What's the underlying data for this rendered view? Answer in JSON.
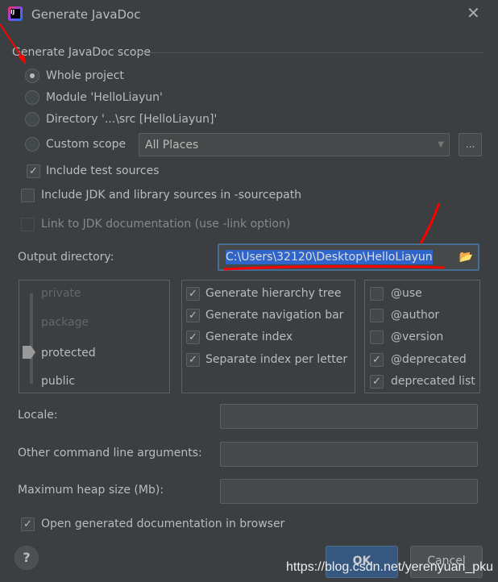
{
  "window": {
    "title": "Generate JavaDoc",
    "icon": "intellij-idea-icon"
  },
  "scope": {
    "title": "Generate JavaDoc scope",
    "options": [
      {
        "label": "Whole project",
        "selected": true
      },
      {
        "label": "Module 'HelloLiayun'",
        "selected": false
      },
      {
        "label": "Directory '...\\src [HelloLiayun]'",
        "selected": false
      },
      {
        "label": "Custom scope",
        "selected": false
      }
    ],
    "custom_scope_value": "All Places",
    "browse_label": "...",
    "include_test": {
      "label": "Include test sources",
      "checked": true
    }
  },
  "include_jdk": {
    "label": "Include JDK and library sources in -sourcepath",
    "checked": false
  },
  "link_jdk": {
    "label": "Link to JDK documentation (use -link option)",
    "checked": false,
    "enabled": false
  },
  "output": {
    "label": "Output directory:",
    "value": "C:\\Users\\32120\\Desktop\\HelloLiayun"
  },
  "visibility": {
    "levels": [
      "private",
      "package",
      "protected",
      "public"
    ],
    "selected": "protected"
  },
  "generate": [
    {
      "label": "Generate hierarchy tree",
      "checked": true
    },
    {
      "label": "Generate navigation bar",
      "checked": true
    },
    {
      "label": "Generate index",
      "checked": true
    },
    {
      "label": "Separate index per letter",
      "checked": true
    }
  ],
  "tags": [
    {
      "label": "@use",
      "checked": false
    },
    {
      "label": "@author",
      "checked": false
    },
    {
      "label": "@version",
      "checked": false
    },
    {
      "label": "@deprecated",
      "checked": true
    },
    {
      "label": "deprecated list",
      "checked": true
    }
  ],
  "locale": {
    "label": "Locale:",
    "value": ""
  },
  "other_args": {
    "label": "Other command line arguments:",
    "value": ""
  },
  "heap": {
    "label": "Maximum heap size (Mb):",
    "value": ""
  },
  "open_browser": {
    "label": "Open generated documentation in browser",
    "checked": true
  },
  "buttons": {
    "help": "?",
    "ok": "OK",
    "cancel": "Cancel"
  },
  "watermark": "https://blog.csdn.net/yerenyuan_pku",
  "colors": {
    "background": "#3c3f41",
    "accent": "#365880",
    "selection": "#2f65ca",
    "annotation": "#ff0000"
  }
}
